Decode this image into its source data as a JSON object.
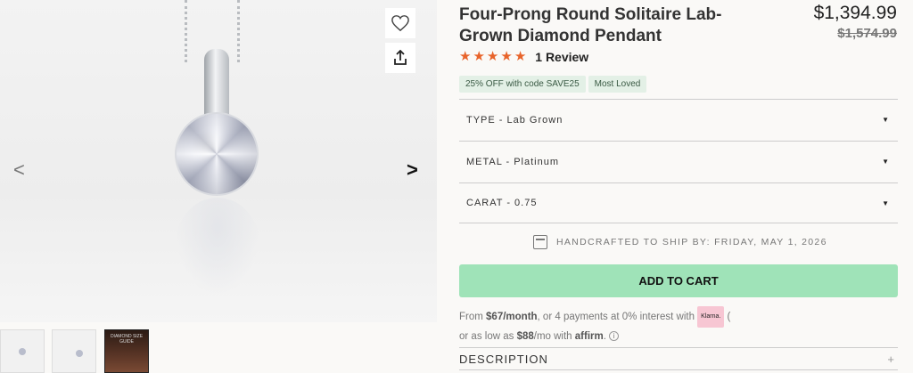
{
  "product": {
    "title": "Four-Prong Round Solitaire Lab-Grown Diamond Pendant",
    "price": "$1,394.99",
    "original_price": "$1,574.99",
    "rating_stars": 5,
    "review_count_label": "1 Review",
    "badges": [
      "25% OFF with code SAVE25",
      "Most Loved"
    ]
  },
  "gallery": {
    "prev_label": "<",
    "next_label": ">",
    "wishlist_icon": "heart-icon",
    "share_icon": "share-icon",
    "thumbnails": [
      {
        "name": "pendant-front"
      },
      {
        "name": "pendant-side"
      },
      {
        "name": "diamond-size-guide",
        "caption": "DIAMOND SIZE GUIDE"
      }
    ]
  },
  "options": [
    {
      "label": "TYPE - Lab Grown"
    },
    {
      "label": "METAL - Platinum"
    },
    {
      "label": "CARAT - 0.75"
    }
  ],
  "shipping": {
    "icon": "calendar-icon",
    "text": "HANDCRAFTED TO SHIP BY: FRIDAY, MAY 1, 2026"
  },
  "cart": {
    "label": "ADD TO CART"
  },
  "financing": {
    "line1_prefix": "From ",
    "monthly": "$67/month",
    "line1_middle": ", or 4 payments at 0% interest with ",
    "klarna": "Klarna.",
    "klarna_trail": "(",
    "line2_prefix": "or as low as ",
    "affirm_amount": "$88",
    "line2_middle": "/mo with ",
    "affirm": "affirm",
    "line2_suffix": ".",
    "info": "i"
  },
  "description": {
    "label": "DESCRIPTION",
    "toggle": "+"
  },
  "colors": {
    "accent_star": "#e8632a",
    "cart_button": "#9fe3b8",
    "badge_bg": "#e3f0e6"
  }
}
